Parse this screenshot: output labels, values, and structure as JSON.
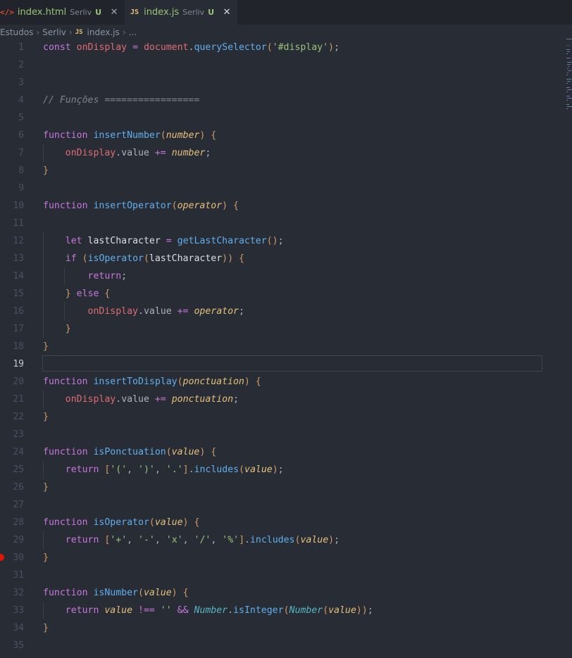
{
  "tabs": [
    {
      "icon": "html-file-icon",
      "name": "index.html",
      "folder": "Serliv",
      "status": "U",
      "active": false
    },
    {
      "icon": "js-file-icon",
      "name": "index.js",
      "folder": "Serliv",
      "status": "U",
      "active": true
    }
  ],
  "breadcrumb": {
    "items": [
      "Estudos",
      "Serliv"
    ],
    "file_badge": "JS",
    "file": "index.js",
    "ellipsis": "..."
  },
  "editor": {
    "current_line": 19,
    "breakpoint_line": 30,
    "line_numbers": [
      "1",
      "2",
      "3",
      "4",
      "5",
      "6",
      "7",
      "8",
      "9",
      "10",
      "11",
      "12",
      "13",
      "14",
      "15",
      "16",
      "17",
      "18",
      "19",
      "20",
      "21",
      "22",
      "23",
      "24",
      "25",
      "26",
      "27",
      "28",
      "29",
      "30",
      "31",
      "32",
      "33",
      "34",
      "35"
    ],
    "lines": [
      "const onDisplay = document.querySelector('#display');",
      "",
      "",
      "// Funções =================",
      "",
      "function insertNumber(number) {",
      "    onDisplay.value += number;",
      "}",
      "",
      "function insertOperator(operator) {",
      "",
      "    let lastCharacter = getLastCharacter();",
      "    if (isOperator(lastCharacter)) {",
      "        return;",
      "    } else {",
      "        onDisplay.value += operator;",
      "    }",
      "}",
      "",
      "function insertToDisplay(ponctuation) {",
      "    onDisplay.value += ponctuation;",
      "}",
      "",
      "function isPonctuation(value) {",
      "    return ['(', ')', '.'].includes(value);",
      "}",
      "",
      "function isOperator(value) {",
      "    return ['+', '-', 'x', '/', '%'].includes(value);",
      "}",
      "",
      "function isNumber(value) {",
      "    return value !== '' && Number.isInteger(Number(value));",
      "}",
      ""
    ]
  },
  "colors": {
    "background": "#282c34",
    "tabbar": "#21252b",
    "keyword": "#c678dd",
    "function": "#61afef",
    "parameter": "#e5c07b",
    "string": "#98c379",
    "comment": "#7f848e",
    "variable": "#e06c75",
    "operator": "#56b6c2",
    "breakpoint": "#e51400"
  }
}
